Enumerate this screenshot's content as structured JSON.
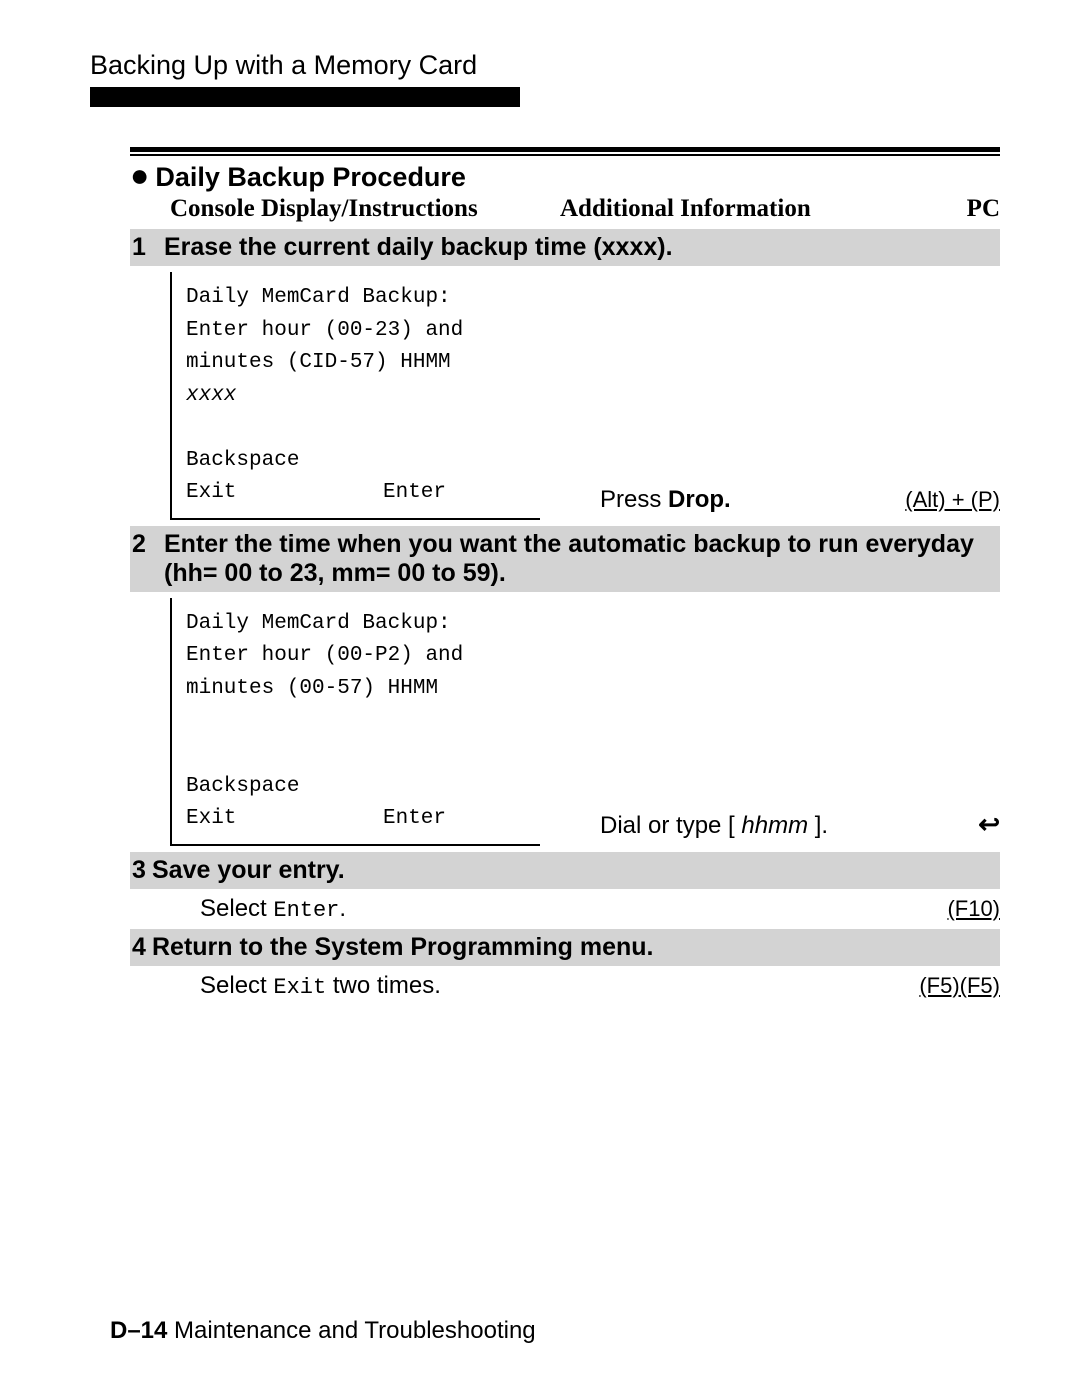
{
  "page": {
    "title": "Backing Up with a Memory Card",
    "footer_bold": "D–14",
    "footer_rest": " Maintenance and Troubleshooting"
  },
  "procedure": {
    "title": "Daily Backup Procedure",
    "col_left": "Console Display/Instructions",
    "col_right": "Additional Information",
    "col_pc": "PC"
  },
  "steps": [
    {
      "num": "1",
      "title": "Erase the current daily backup time (xxxx).",
      "console": {
        "line1": "Daily MemCard Backup:",
        "line2": "Enter hour (00-23) and",
        "line3": "minutes (CID-57) HHMM",
        "line4": "xxxx",
        "spacer": " ",
        "line5": "Backspace",
        "exit": "Exit",
        "enter": "Enter"
      },
      "info_prefix": "Press ",
      "info_strong": "Drop.",
      "key": "(Alt) + (P)"
    },
    {
      "num": "2",
      "title": "Enter the time when you want the automatic backup to run everyday (hh= 00 to 23, mm= 00 to 59).",
      "console": {
        "line1": "Daily MemCard Backup:",
        "line2": "Enter hour (00-P2) and",
        "line3": "minutes (00-57) HHMM",
        "spacer1": " ",
        "spacer2": " ",
        "line5": "Backspace",
        "exit": "Exit",
        "enter": "Enter"
      },
      "info_prefix": "Dial or type [ ",
      "info_ital": "hhmm",
      "info_suffix": " ].",
      "icon": "↩"
    },
    {
      "num": "3",
      "title": "Save your entry.",
      "action_prefix": "Select ",
      "action_mono": "Enter",
      "action_suffix": ".",
      "key": "(F10)"
    },
    {
      "num": "4",
      "title": "Return to the System Programming menu.",
      "action_prefix": "Select ",
      "action_mono": "Exit",
      "action_suffix": " two times.",
      "key": "(F5)(F5)"
    }
  ]
}
